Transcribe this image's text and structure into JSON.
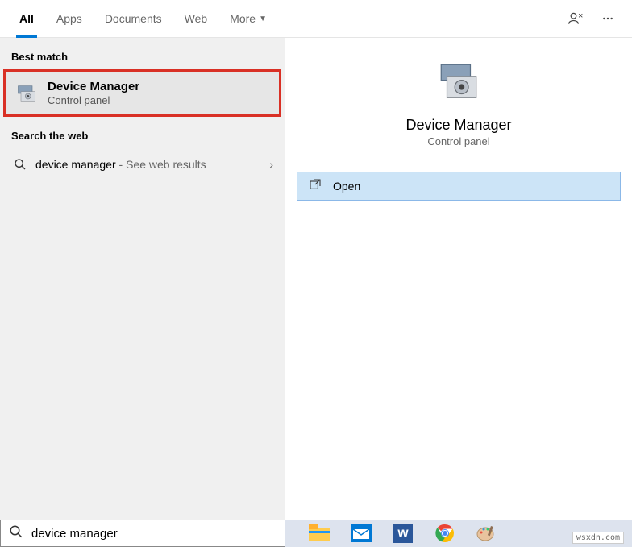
{
  "tabs": {
    "all": "All",
    "apps": "Apps",
    "documents": "Documents",
    "web": "Web",
    "more": "More"
  },
  "sections": {
    "best_match": "Best match",
    "search_web": "Search the web"
  },
  "result": {
    "title": "Device Manager",
    "sub": "Control panel"
  },
  "web": {
    "query": "device manager",
    "suffix": " - See web results"
  },
  "preview": {
    "title": "Device Manager",
    "sub": "Control panel"
  },
  "action": {
    "open": "Open"
  },
  "search": {
    "value": "device manager"
  },
  "watermark": "wsxdn.com"
}
